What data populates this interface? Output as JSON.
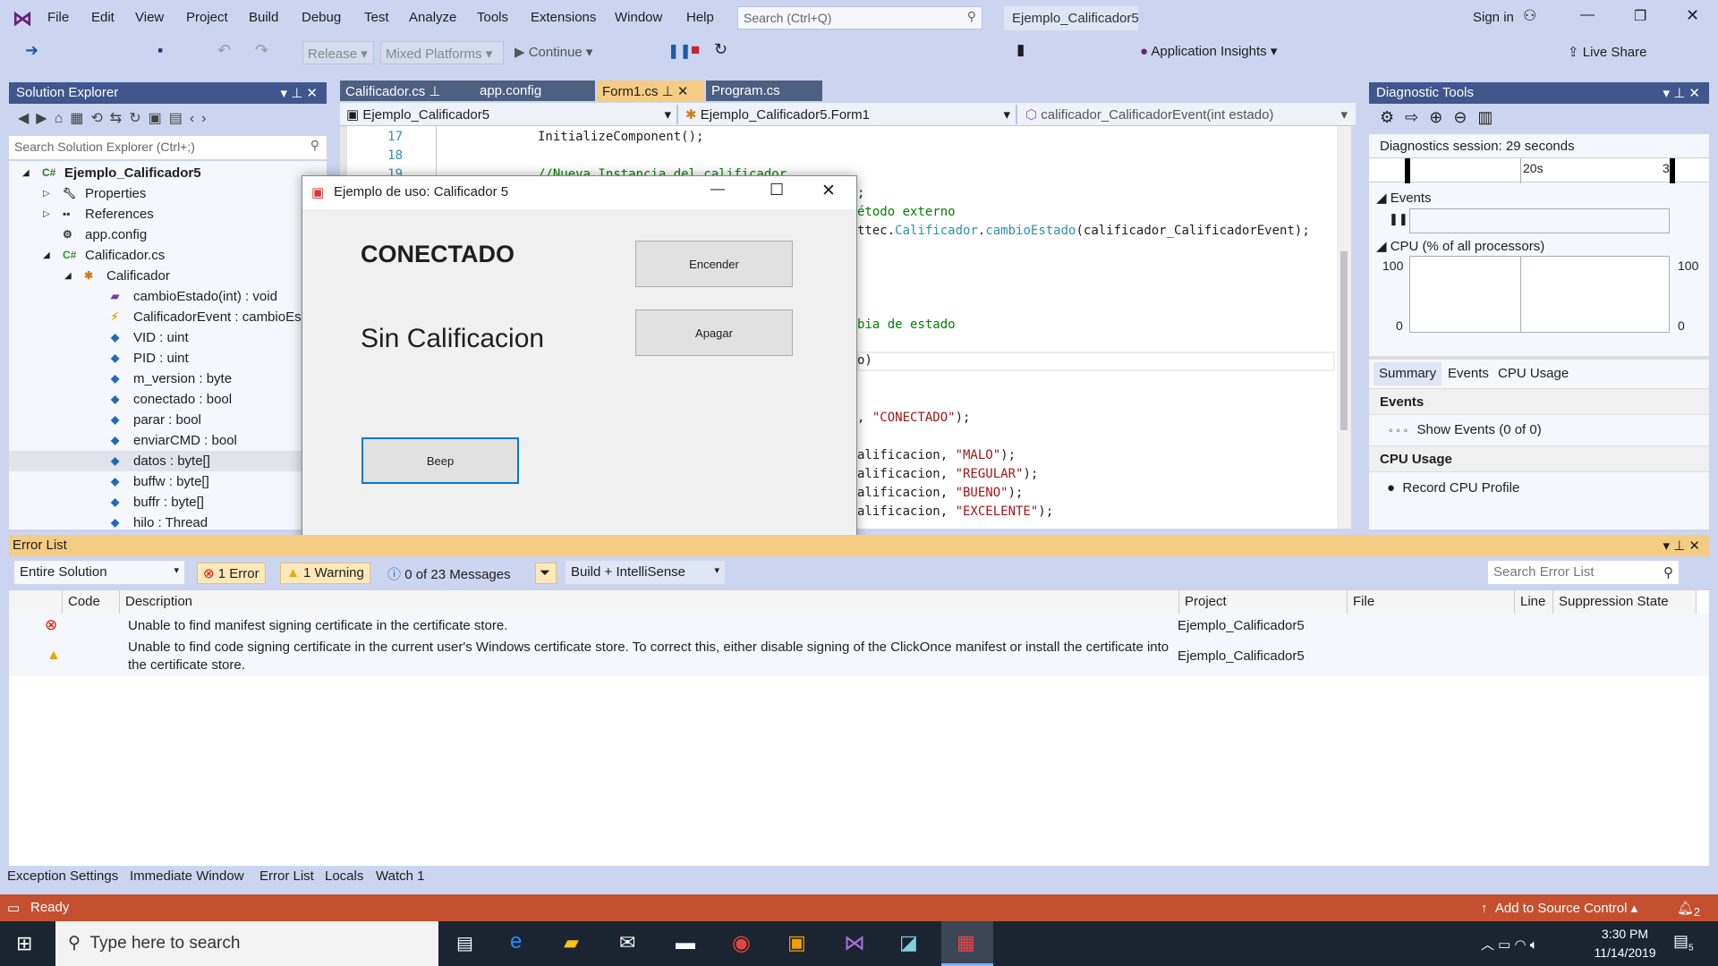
{
  "menu": {
    "items": [
      "File",
      "Edit",
      "View",
      "Project",
      "Build",
      "Debug",
      "Test",
      "Analyze",
      "Tools",
      "Extensions",
      "Window",
      "Help"
    ],
    "search_placeholder": "Search (Ctrl+Q)",
    "solution_name": "Ejemplo_Calificador5",
    "sign_in": "Sign in"
  },
  "toolbar": {
    "config": "Release",
    "platform": "Mixed Platforms",
    "continue": "Continue",
    "app_insights": "Application Insights",
    "live_share": "Live Share"
  },
  "solution_explorer": {
    "title": "Solution Explorer",
    "search_placeholder": "Search Solution Explorer (Ctrl+;)",
    "items": [
      {
        "label": "Ejemplo_Calificador5",
        "level": 0,
        "icon": "csharp-project-icon"
      },
      {
        "label": "Properties",
        "level": 1,
        "icon": "wrench-icon"
      },
      {
        "label": "References",
        "level": 1,
        "icon": "references-icon"
      },
      {
        "label": "app.config",
        "level": 1,
        "icon": "config-file-icon"
      },
      {
        "label": "Calificador.cs",
        "level": 1,
        "icon": "csharp-file-icon"
      },
      {
        "label": "Calificador",
        "level": 2,
        "icon": "class-icon"
      },
      {
        "label": "cambioEstado(int) : void",
        "level": 3,
        "icon": "method-icon"
      },
      {
        "label": "CalificadorEvent : cambioEsta",
        "level": 3,
        "icon": "event-icon"
      },
      {
        "label": "VID : uint",
        "level": 3,
        "icon": "field-icon"
      },
      {
        "label": "PID : uint",
        "level": 3,
        "icon": "field-icon"
      },
      {
        "label": "m_version : byte",
        "level": 3,
        "icon": "field-icon"
      },
      {
        "label": "conectado : bool",
        "level": 3,
        "icon": "field-icon"
      },
      {
        "label": "parar : bool",
        "level": 3,
        "icon": "field-icon"
      },
      {
        "label": "enviarCMD : bool",
        "level": 3,
        "icon": "field-icon"
      },
      {
        "label": "datos : byte[]",
        "level": 3,
        "icon": "field-icon"
      },
      {
        "label": "buffw : byte[]",
        "level": 3,
        "icon": "field-icon"
      },
      {
        "label": "buffr : byte[]",
        "level": 3,
        "icon": "field-icon"
      },
      {
        "label": "hilo : Thread",
        "level": 3,
        "icon": "field-icon"
      }
    ]
  },
  "editor": {
    "tabs": [
      "Calificador.cs",
      "app.config",
      "Form1.cs",
      "Program.cs"
    ],
    "active_tab": "Form1.cs",
    "nav": [
      "Ejemplo_Calificador5",
      "Ejemplo_Calificador5.Form1",
      "calificador_CalificadorEvent(int estado)"
    ],
    "line_numbers": [
      "17",
      "18",
      "19"
    ],
    "lines": [
      {
        "text": "InitializeComponent();",
        "cls": ""
      },
      {
        "text": "//Nueva Instancia del calificador",
        "cls": "cm"
      },
      {
        "text": ";",
        "cls": ""
      },
      {
        "text": "étodo externo",
        "cls": "cm"
      },
      {
        "text": "ttec.",
        "cls": "",
        "t2": "Calificador",
        "t3": ".",
        "t4": "cambioEstado",
        "t5": "(calificador_CalificadorEvent);"
      },
      {
        "text": "bia de estado",
        "cls": "cm"
      },
      {
        "text": "o)",
        "cls": ""
      },
      {
        "text": ", ",
        "cls": "",
        "s": "\"CONECTADO\"",
        "e": ");"
      },
      {
        "text": "alificacion, ",
        "s": "\"MALO\"",
        "e": ");"
      },
      {
        "text": "alificacion, ",
        "s": "\"REGULAR\"",
        "e": ");"
      },
      {
        "text": "alificacion, ",
        "s": "\"BUENO\"",
        "e": ");"
      },
      {
        "text": "alificacion, ",
        "s": "\"EXCELENTE\"",
        "e": ");"
      }
    ]
  },
  "dialog": {
    "title": "Ejemplo de uso: Calificador 5",
    "status": "CONECTADO",
    "rating": "Sin Calificacion",
    "encender": "Encender",
    "apagar": "Apagar",
    "beep": "Beep"
  },
  "diagnostics": {
    "title": "Diagnostic Tools",
    "session": "Diagnostics session: 29 seconds",
    "tick": "20s",
    "tick_end": "3",
    "events_label": "Events",
    "cpu_label": "CPU (% of all processors)",
    "cpu_max": "100",
    "cpu_min": "0",
    "tabs": [
      "Summary",
      "Events",
      "CPU Usage"
    ],
    "active_tab": "Summary",
    "events_header": "Events",
    "show_events": "Show Events (0 of 0)",
    "cpu_header": "CPU Usage",
    "record_cpu": "Record CPU Profile"
  },
  "error_list": {
    "title": "Error List",
    "scope": "Entire Solution",
    "errors": "1 Error",
    "warnings": "1 Warning",
    "messages": "0 of 23 Messages",
    "build_filter": "Build + IntelliSense",
    "search_placeholder": "Search Error List",
    "columns": [
      "Code",
      "Description",
      "Project",
      "File",
      "Line",
      "Suppression State"
    ],
    "rows": [
      {
        "severity": "error",
        "description": "Unable to find manifest signing certificate in the certificate store.",
        "project": "Ejemplo_Calificador5"
      },
      {
        "severity": "warning",
        "description": "Unable to find code signing certificate in the current user's Windows certificate store. To correct this, either disable signing of the ClickOnce manifest or install the certificate into the certificate store.",
        "project": "Ejemplo_Calificador5"
      }
    ]
  },
  "bottom_tabs": [
    "Exception Settings",
    "Immediate Window",
    "Error List",
    "Locals",
    "Watch 1"
  ],
  "status": {
    "text": "Ready",
    "source_control": "Add to Source Control",
    "notifications": "2"
  },
  "taskbar": {
    "search_placeholder": "Type here to search",
    "time": "3:30 PM",
    "date": "11/14/2019",
    "notif_count": "5"
  },
  "colors": {
    "accent": "#40568d",
    "status_bar": "#c5502f",
    "error_header": "#f5cc84"
  }
}
